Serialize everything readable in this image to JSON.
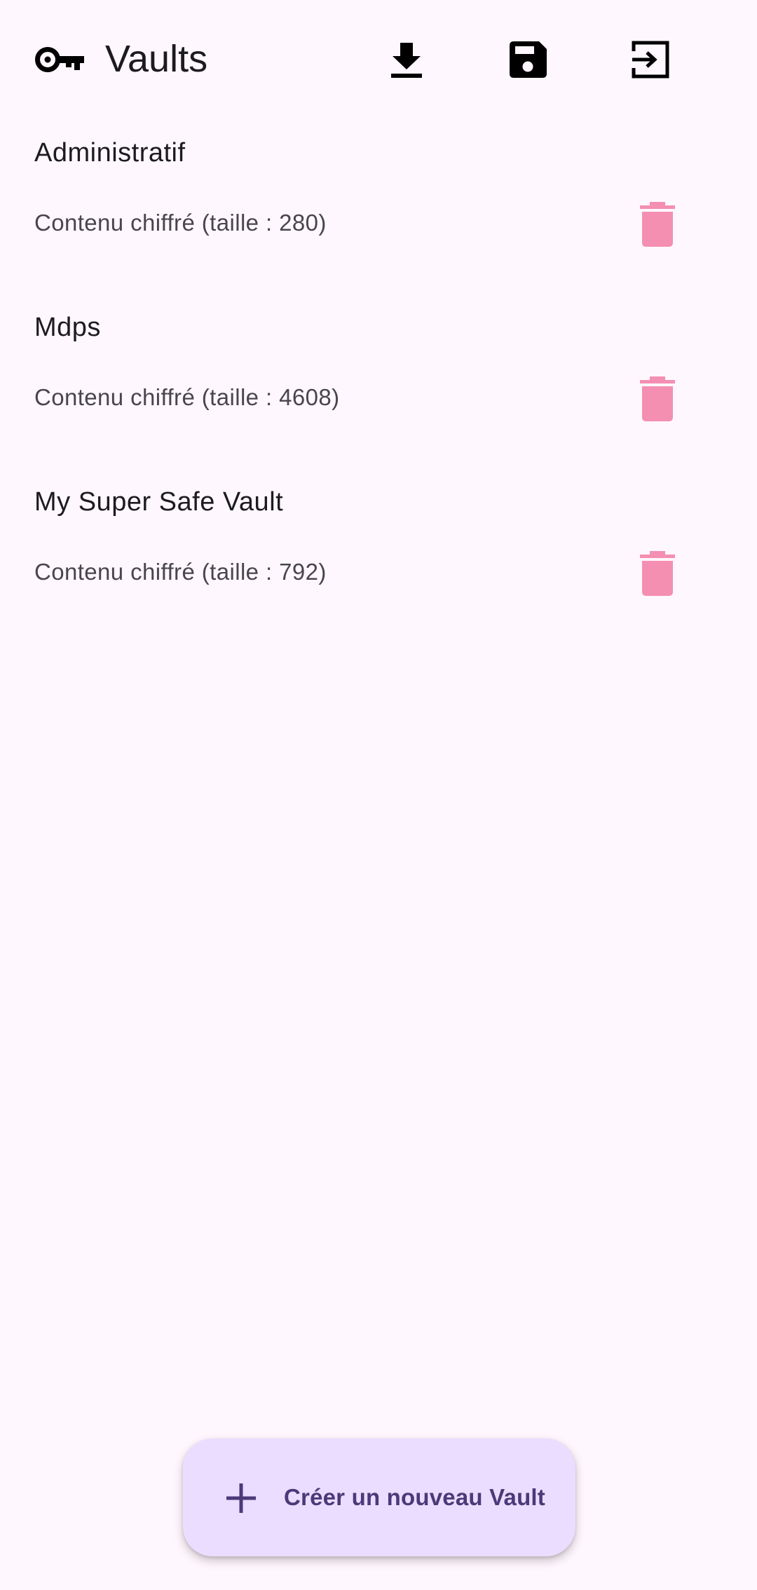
{
  "app_bar": {
    "title": "Vaults",
    "icon": "key-icon",
    "actions": [
      {
        "name": "download",
        "icon": "download-icon"
      },
      {
        "name": "save",
        "icon": "save-icon"
      },
      {
        "name": "exit",
        "icon": "exit-icon"
      }
    ]
  },
  "vaults": [
    {
      "name": "Administratif",
      "description": "Contenu chiffré (taille : 280)"
    },
    {
      "name": "Mdps",
      "description": "Contenu chiffré (taille : 4608)"
    },
    {
      "name": "My Super Safe Vault",
      "description": "Contenu chiffré (taille : 792)"
    }
  ],
  "delete_icon": "trash-icon",
  "fab": {
    "icon": "plus-icon",
    "label": "Créer un nouveau Vault"
  },
  "colors": {
    "background": "#FFF7FE",
    "delete": "#F48FB1",
    "fab_background": "#EADDFF",
    "fab_text": "#4A3A78"
  }
}
